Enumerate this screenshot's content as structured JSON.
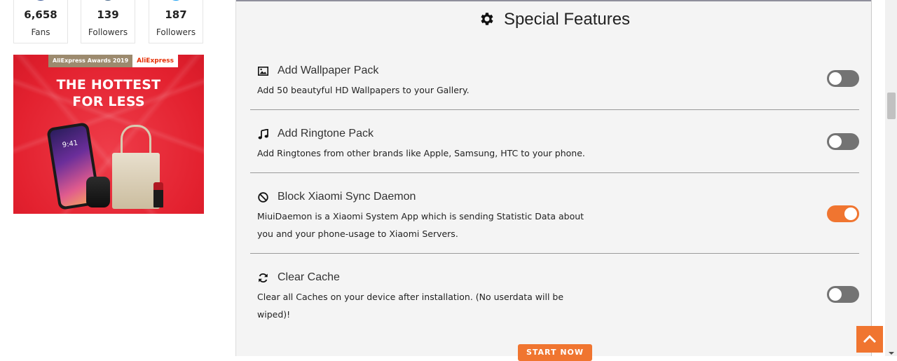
{
  "social": [
    {
      "count": "6,658",
      "label": "Fans",
      "icon": "facebook-icon",
      "color": "#3b5998"
    },
    {
      "count": "139",
      "label": "Followers",
      "icon": "instagram-icon",
      "color": "#4a6a8a"
    },
    {
      "count": "187",
      "label": "Followers",
      "icon": "twitter-icon",
      "color": "#1da1f2"
    }
  ],
  "ad": {
    "award": "AliExpress Awards 2019",
    "brand": "AliExpress",
    "headline_line1": "THE HOTTEST",
    "headline_line2": "FOR LESS",
    "phone_time": "9:41"
  },
  "panel": {
    "title": "Special Features",
    "title_icon": "gear-icon",
    "features": [
      {
        "title": "Add Wallpaper Pack",
        "icon": "image-icon",
        "desc": "Add 50 beautyful HD Wallpapers to your Gallery.",
        "enabled": false
      },
      {
        "title": "Add Ringtone Pack",
        "icon": "music-note-icon",
        "desc": "Add Ringtones from other brands like Apple, Samsung, HTC to your phone.",
        "enabled": false
      },
      {
        "title": "Block Xiaomi Sync Daemon",
        "icon": "ban-icon",
        "desc_line1": "MiuiDaemon is a Xiaomi System App which is sending Statistic Data about",
        "desc_line2": "you and your phone-usage to Xiaomi Servers.",
        "enabled": true
      },
      {
        "title": "Clear Cache",
        "icon": "refresh-icon",
        "desc_line1": "Clear all Caches on your device after installation. (No userdata will be",
        "desc_line2": "wiped)!",
        "enabled": false
      }
    ],
    "start_button": "START NOW"
  },
  "colors": {
    "accent": "#f07530",
    "toggle_off": "#737373",
    "ad_red": "#e3212f"
  }
}
